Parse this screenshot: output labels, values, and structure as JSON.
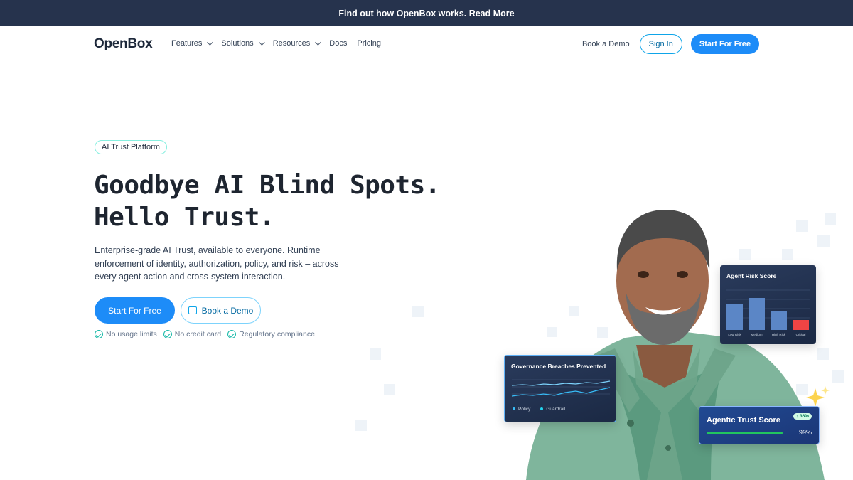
{
  "announcement": "Find out how OpenBox works. Read More",
  "nav": {
    "logo": "OpenBox",
    "items": [
      {
        "label": "Features",
        "dropdown": true
      },
      {
        "label": "Solutions",
        "dropdown": true
      },
      {
        "label": "Resources",
        "dropdown": true
      },
      {
        "label": "Docs",
        "dropdown": false
      },
      {
        "label": "Pricing",
        "dropdown": false
      }
    ],
    "book_demo": "Book a Demo",
    "sign_in": "Sign In",
    "start_free": "Start For Free"
  },
  "hero": {
    "badge": "AI Trust Platform",
    "headline_line1": "Goodbye AI Blind Spots.",
    "headline_line2": "Hello Trust.",
    "subtext": "Enterprise-grade AI Trust, available to everyone. Runtime enforcement of identity, authorization, policy, and risk – across every agent action and cross-system interaction.",
    "cta_primary": "Start For Free",
    "cta_secondary": "Book a Demo",
    "checks": [
      "No usage limits",
      "No credit card",
      "Regulatory compliance"
    ]
  },
  "cards": {
    "risk": {
      "title": "Agent Risk Score",
      "categories": [
        "Low Risk",
        "Medium",
        "High Risk",
        "Critical"
      ],
      "values": [
        0.72,
        0.9,
        0.52,
        0.28
      ],
      "colors": [
        "#5b86c6",
        "#5b86c6",
        "#5b86c6",
        "#ef4444"
      ]
    },
    "governance": {
      "title": "Governance Breaches Prevented",
      "legend": [
        "Policy",
        "Guardrail"
      ],
      "legend_colors": [
        "#38bdf8",
        "#22d3ee"
      ]
    },
    "trust": {
      "title": "Agentic Trust Score",
      "change": "↑ 36%",
      "value": "99%",
      "level": 0.99
    }
  },
  "colors": {
    "accent": "#1d8cf8",
    "announce_bg": "#26334d",
    "teal": "#14b8a6"
  }
}
